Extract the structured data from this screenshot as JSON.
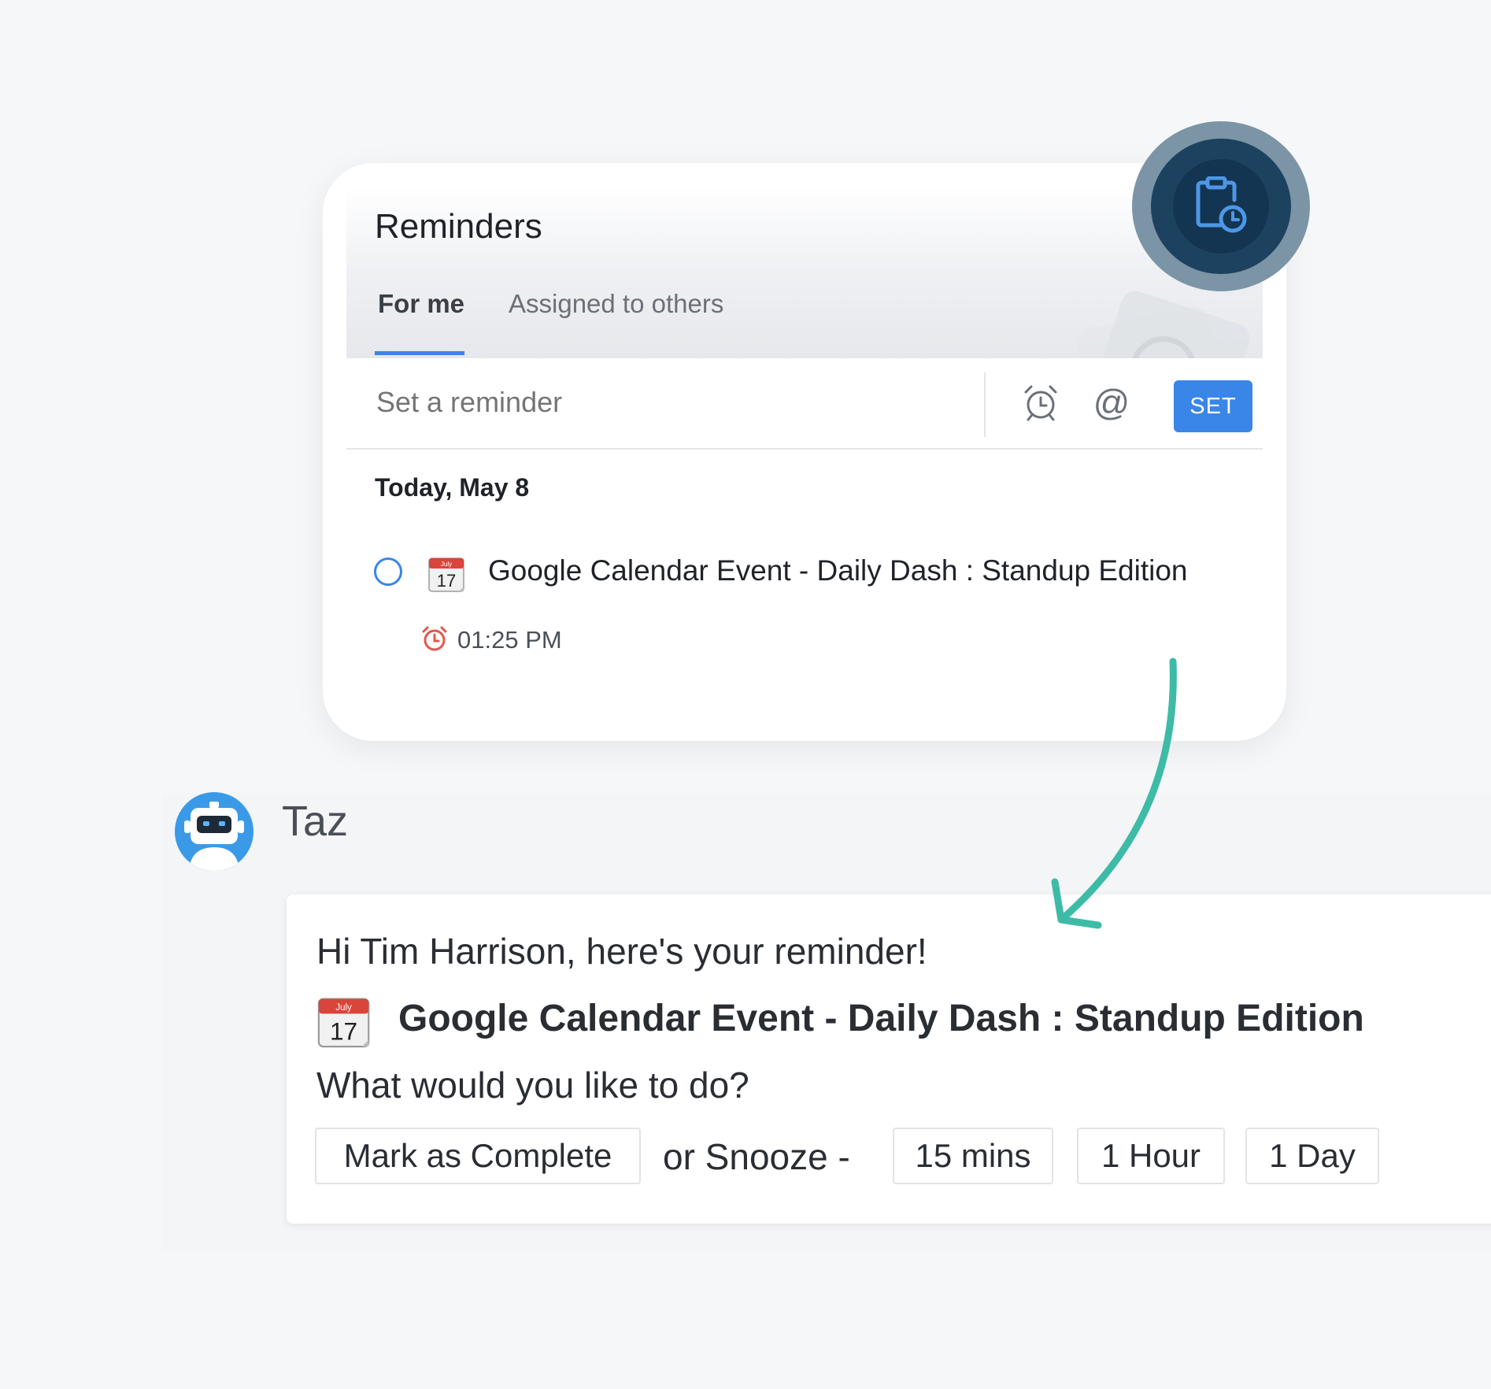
{
  "reminders": {
    "title": "Reminders",
    "tabs": [
      {
        "label": "For me",
        "active": true
      },
      {
        "label": "Assigned to others",
        "active": false
      }
    ],
    "input_placeholder": "Set a reminder",
    "set_label": "SET",
    "date_heading": "Today, May 8",
    "items": [
      {
        "text": "Google Calendar Event - Daily Dash : Standup Edition",
        "time": "01:25 PM",
        "calendar_month": "July",
        "calendar_day": "17"
      }
    ]
  },
  "chat": {
    "sender": "Taz",
    "greeting": "Hi Tim Harrison, here's your reminder!",
    "event_title": "Google Calendar Event - Daily Dash : Standup Edition",
    "calendar_month": "July",
    "calendar_day": "17",
    "question": "What would you like to do?",
    "mark_complete": "Mark as Complete",
    "or_snooze": "or  Snooze -",
    "snooze_options": [
      "15 mins",
      "1 Hour",
      "1 Day"
    ]
  },
  "colors": {
    "accent": "#3a86e8",
    "fab": "#143552",
    "arrow": "#3dbba6",
    "alarm_red": "#e2574c"
  }
}
